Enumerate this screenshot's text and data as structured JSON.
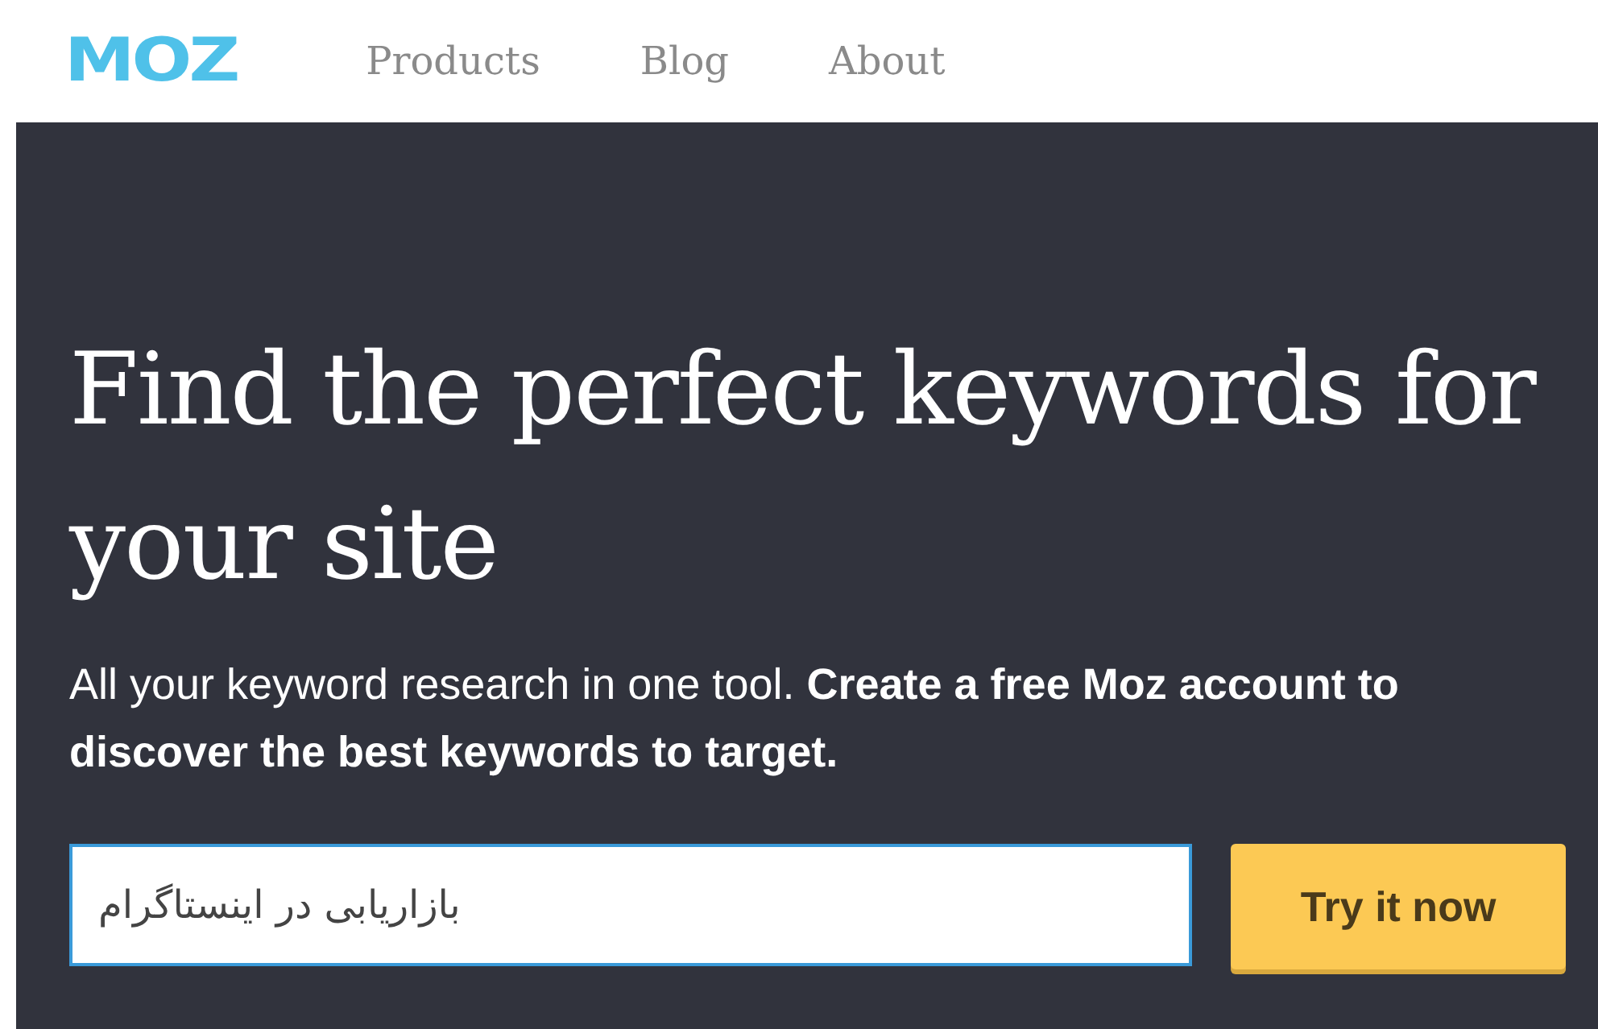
{
  "nav": {
    "logo": "MOZ",
    "links": [
      {
        "label": "Products"
      },
      {
        "label": "Blog"
      },
      {
        "label": "About"
      }
    ]
  },
  "hero": {
    "title": "Find the perfect keywords for your site",
    "subtitle": "All your keyword research in one tool. **Create a free Moz account to discover the best keywords to target.**",
    "search": {
      "value": "بازاریابی در اینستاگرام"
    },
    "button": "Try it now"
  }
}
